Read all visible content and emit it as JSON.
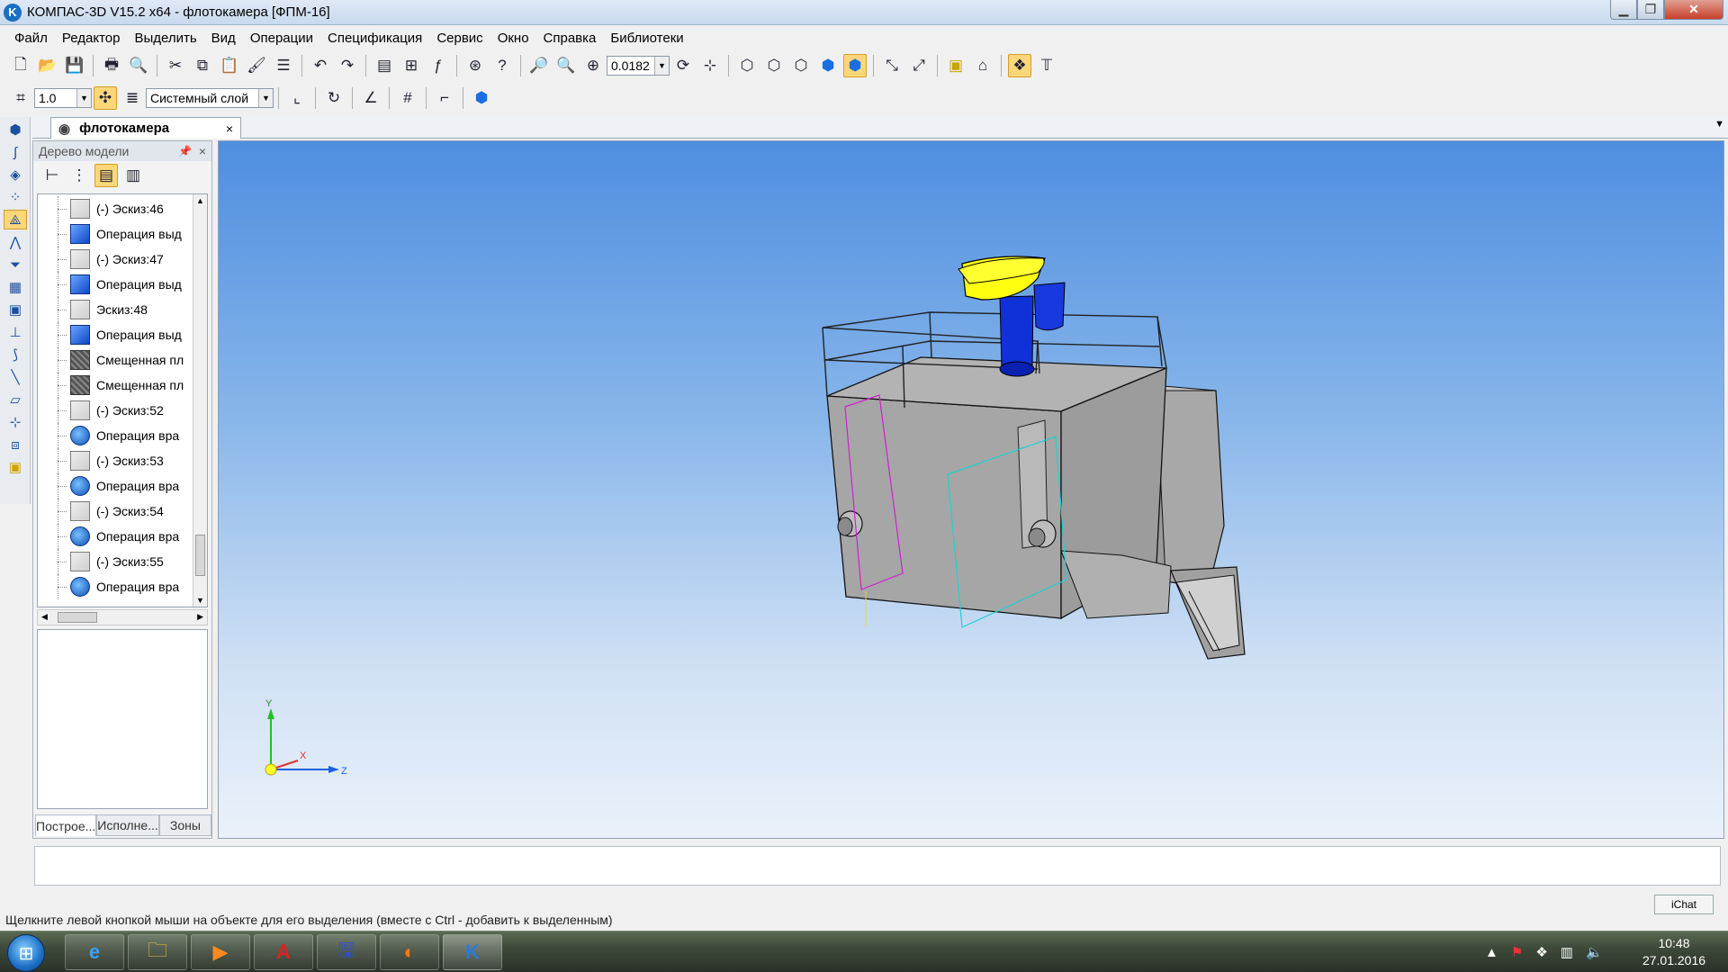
{
  "window": {
    "title": "КОМПАС-3D V15.2  x64 - флотокамера [ФПМ-16]",
    "app_icon": "kompas-logo-icon",
    "controls": [
      "minimize-icon",
      "maximize-icon",
      "close-icon"
    ]
  },
  "menu": [
    "Файл",
    "Редактор",
    "Выделить",
    "Вид",
    "Операции",
    "Спецификация",
    "Сервис",
    "Окно",
    "Справка",
    "Библиотеки"
  ],
  "toolbar1": {
    "zoom_value": "0.0182"
  },
  "toolbar2": {
    "step_value": "1.0",
    "layer_value": "Системный слой"
  },
  "document_tab": {
    "label": "флотокамера",
    "close": "×"
  },
  "model_tree": {
    "header": "Дерево модели",
    "pin": "ᴘ",
    "close": "×",
    "items": [
      {
        "label": "(-) Эскиз:46",
        "icon": "sketch-icon"
      },
      {
        "label": "Операция выд",
        "icon": "extrude-icon"
      },
      {
        "label": "(-) Эскиз:47",
        "icon": "sketch-icon"
      },
      {
        "label": "Операция выд",
        "icon": "extrude-icon"
      },
      {
        "label": "Эскиз:48",
        "icon": "sketch-icon"
      },
      {
        "label": "Операция выд",
        "icon": "extrude-icon"
      },
      {
        "label": "Смещенная пл",
        "icon": "offset-plane-icon"
      },
      {
        "label": "Смещенная пл",
        "icon": "offset-plane-icon"
      },
      {
        "label": "(-) Эскиз:52",
        "icon": "sketch-icon"
      },
      {
        "label": "Операция вра",
        "icon": "revolve-icon"
      },
      {
        "label": "(-) Эскиз:53",
        "icon": "sketch-icon"
      },
      {
        "label": "Операция вра",
        "icon": "revolve-icon"
      },
      {
        "label": "(-) Эскиз:54",
        "icon": "sketch-icon"
      },
      {
        "label": "Операция вра",
        "icon": "revolve-icon"
      },
      {
        "label": "(-) Эскиз:55",
        "icon": "sketch-icon"
      },
      {
        "label": "Операция вра",
        "icon": "revolve-icon"
      }
    ],
    "tabs": [
      "Построе...",
      "Исполне...",
      "Зоны"
    ]
  },
  "axes": {
    "x": "X",
    "y": "Y",
    "z": "Z"
  },
  "statusbar": {
    "text": "Щелкните левой кнопкой мыши на объекте для его выделения (вместе с Ctrl - добавить к выделенным)"
  },
  "ichat": "iChat",
  "taskbar": {
    "apps": [
      "internet-explorer-icon",
      "file-explorer-icon",
      "media-player-icon",
      "autocad-icon",
      "save-disk-icon",
      "firefox-icon",
      "kompas-icon"
    ],
    "time": "10:48",
    "date": "27.01.2016"
  },
  "colors": {
    "viewport_top": "#4f8ee0",
    "viewport_bottom": "#eaf1fa",
    "body_gray": "#a3a3a3",
    "pipe_blue": "#1030d8",
    "cap_yellow": "#ffff10",
    "accent": "#fbd77a"
  }
}
